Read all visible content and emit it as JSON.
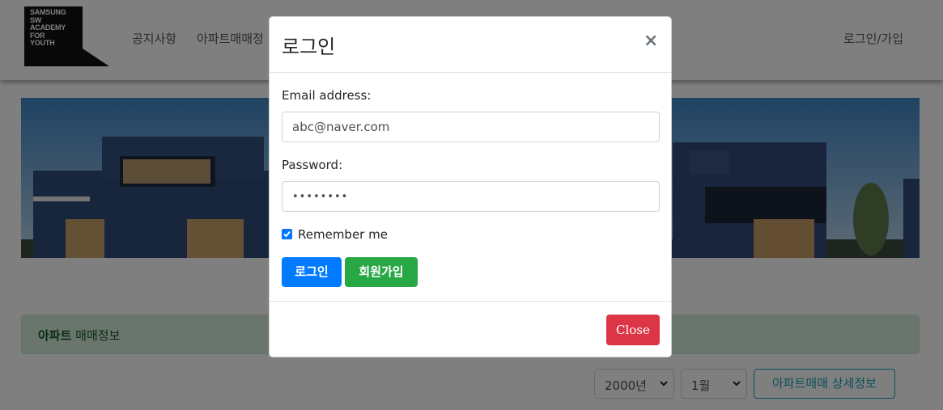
{
  "navbar": {
    "logo_lines": [
      "SAMSUNG",
      "SW",
      "ACADEMY",
      "FOR",
      "YOUTH"
    ],
    "menu": [
      "공지사항",
      "아파트매매정"
    ],
    "login_link": "로그인/가입"
  },
  "alert": {
    "bold": "아파트",
    "text": " 매매정보"
  },
  "filters": {
    "year": "2000년",
    "month": "1월",
    "detail_button": "아파트매매 상세정보"
  },
  "modal": {
    "title": "로그인",
    "close_symbol": "×",
    "email_label": "Email address:",
    "email_value": "abc@naver.com",
    "password_label": "Password:",
    "password_value": "••••••••",
    "remember_label": "Remember me",
    "remember_checked": true,
    "login_button": "로그인",
    "signup_button": "회원가입",
    "close_button": "Close"
  },
  "colors": {
    "primary": "#007bff",
    "success": "#28a745",
    "danger": "#dc3545",
    "info": "#17a2b8",
    "alert_bg": "#d4edda"
  }
}
